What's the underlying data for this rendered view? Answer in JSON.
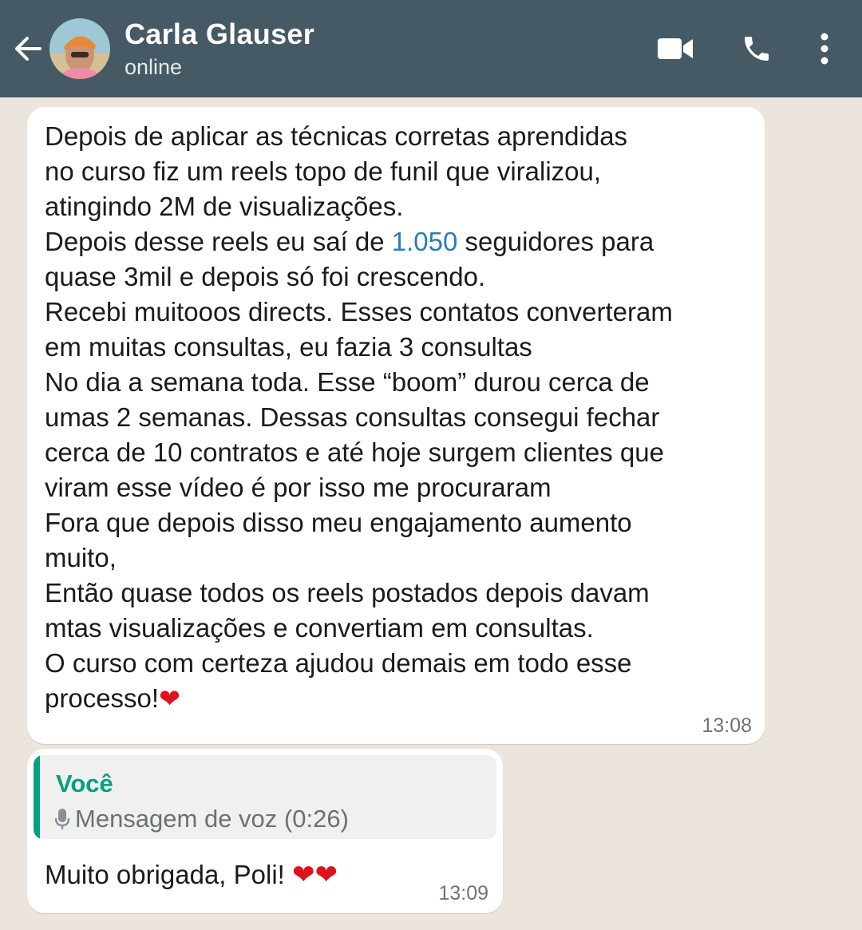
{
  "header": {
    "contact_name": "Carla Glauser",
    "status": "online",
    "background_color": "#455a64",
    "icons": [
      "arrow-left-icon",
      "video-call-icon",
      "phone-icon",
      "more-vertical-icon"
    ]
  },
  "messages": [
    {
      "direction": "incoming",
      "lines": [
        "Depois de aplicar as técnicas corretas aprendidas",
        "no curso fiz um reels topo de funil que viralizou,",
        "atingindo 2M de visualizações.",
        "Depois desse reels eu saí de ",
        "1.050",
        " seguidores para",
        "quase 3mil e depois só foi crescendo.",
        "Recebi muitooos directs. Esses contatos converteram",
        "em muitas consultas, eu fazia 3 consultas",
        "No dia a semana toda. Esse “boom” durou cerca de",
        "umas 2 semanas. Dessas consultas consegui fechar",
        "cerca de 10 contratos e até hoje surgem clientes que",
        "viram esse vídeo é por isso me procuraram",
        "Fora que depois disso meu engajamento aumento",
        "muito,",
        "Então quase todos os reels postados depois davam",
        "mtas visualizações e convertiam em consultas.",
        "O curso com certeza ajudou demais em todo esse",
        "processo!",
        "❤"
      ],
      "time": "13:08"
    },
    {
      "direction": "incoming",
      "quote": {
        "author": "Você",
        "text": "Mensagem de voz (0:26)",
        "icon": "microphone-icon",
        "accent_color": "#06a07e"
      },
      "text": "Muito obrigada, Poli! ",
      "emoji": "❤❤",
      "time": "13:09"
    }
  ],
  "colors": {
    "wallpaper": "#ece5dd",
    "bubble": "#ffffff",
    "link": "#2a7cba",
    "heart": "#e0101c"
  }
}
